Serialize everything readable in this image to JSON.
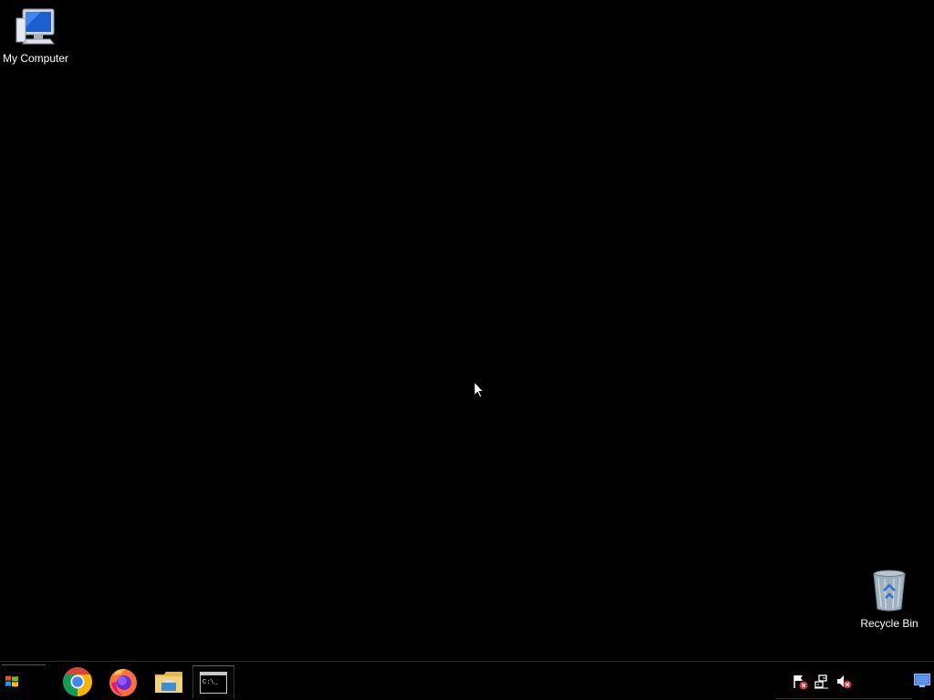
{
  "desktop": {
    "icons": [
      {
        "label": "My Computer",
        "icon": "my-computer-icon"
      },
      {
        "label": "Recycle Bin",
        "icon": "recycle-bin-icon"
      }
    ]
  },
  "taskbar": {
    "start": {
      "icon": "windows-logo-icon"
    },
    "apps": [
      {
        "icon": "chrome-icon"
      },
      {
        "icon": "firefox-icon"
      },
      {
        "icon": "file-explorer-icon"
      },
      {
        "icon": "command-prompt-icon",
        "text": "C:\\_"
      }
    ],
    "tray": [
      {
        "icon": "action-center-flag-icon"
      },
      {
        "icon": "network-icon"
      },
      {
        "icon": "volume-muted-icon"
      }
    ],
    "show_desktop": {
      "icon": "show-desktop-icon"
    }
  },
  "colors": {
    "background": "#000000",
    "chrome_red": "#db4437",
    "chrome_green": "#0f9d58",
    "chrome_yellow": "#f4b400",
    "chrome_blue": "#4285f4",
    "firefox_orange": "#ff7139",
    "firefox_purple": "#6a2bd8",
    "folder_yellow": "#f4d27a"
  }
}
